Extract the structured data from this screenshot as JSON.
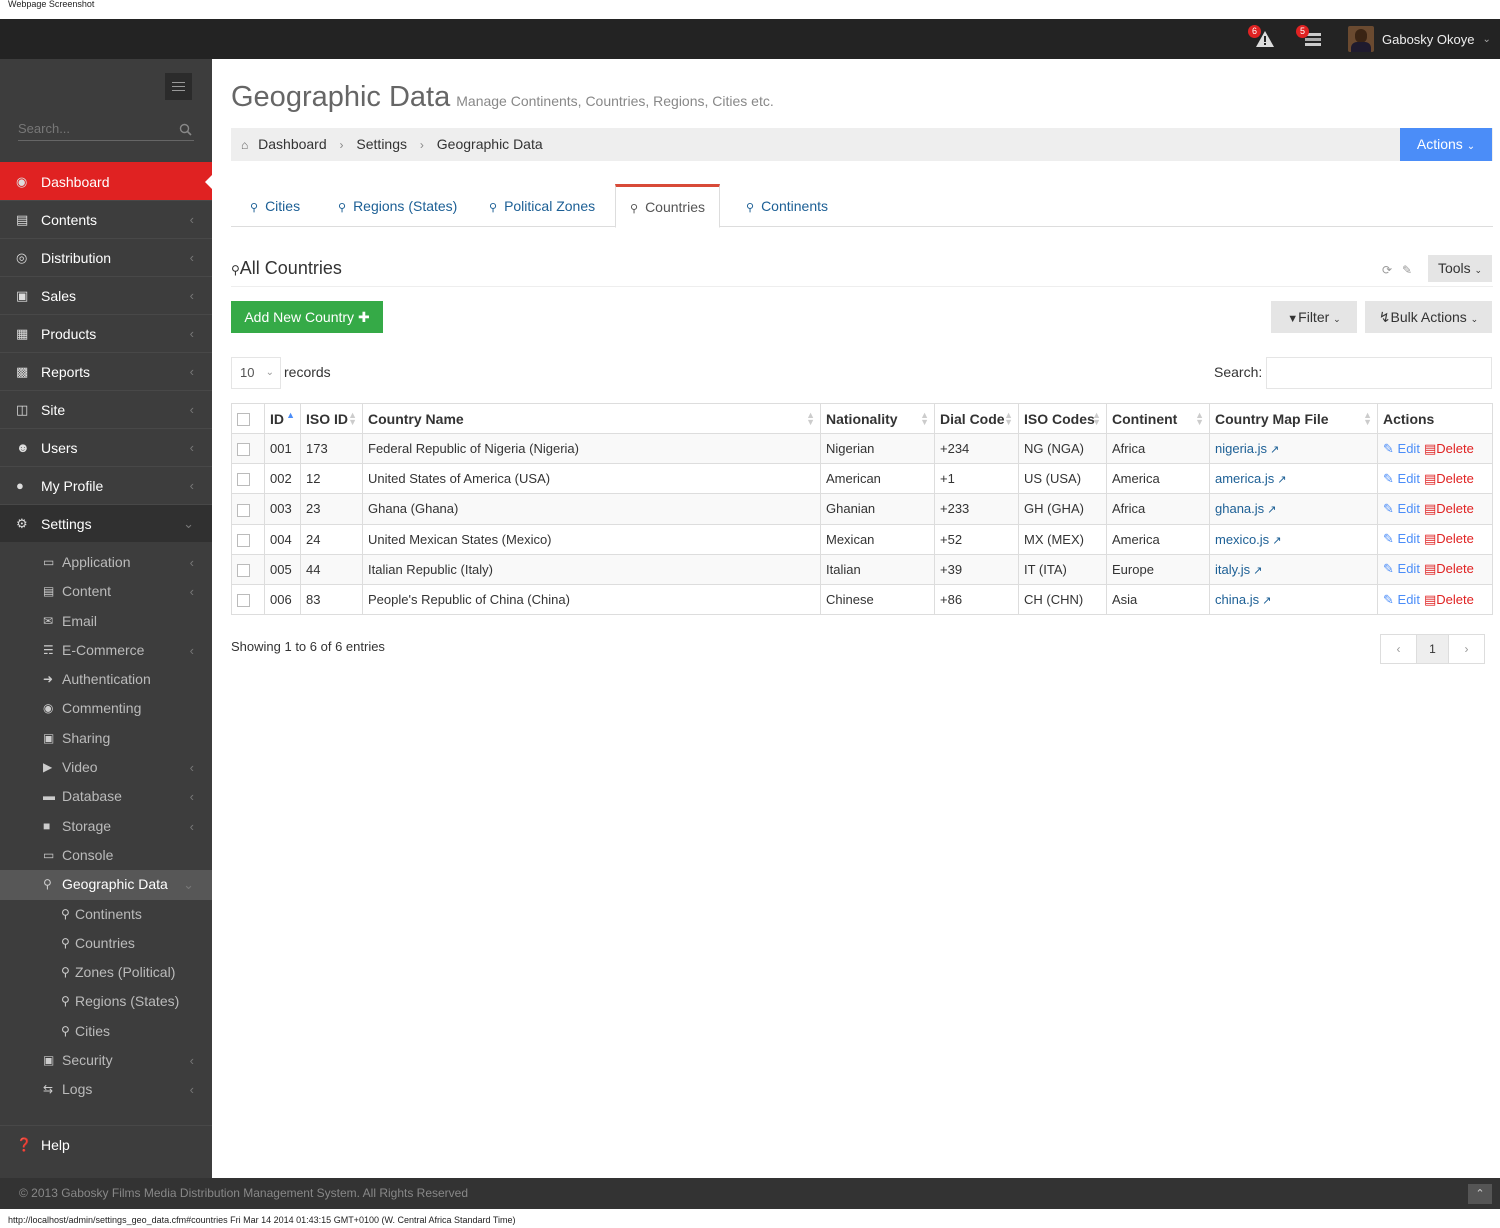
{
  "screenshot_label": "Webpage Screenshot",
  "topbar": {
    "alerts_count": "6",
    "messages_count": "5",
    "user_name": "Gabosky Okoye"
  },
  "sidebar": {
    "search_placeholder": "Search...",
    "items": [
      {
        "label": "Dashboard",
        "icon": "dashboard-icon"
      },
      {
        "label": "Contents",
        "icon": "file-icon"
      },
      {
        "label": "Distribution",
        "icon": "globe-icon"
      },
      {
        "label": "Sales",
        "icon": "money-icon"
      },
      {
        "label": "Products",
        "icon": "briefcase-icon"
      },
      {
        "label": "Reports",
        "icon": "bar-chart-icon"
      },
      {
        "label": "Site",
        "icon": "folder-open-icon"
      },
      {
        "label": "Users",
        "icon": "group-icon"
      },
      {
        "label": "My Profile",
        "icon": "user-icon"
      },
      {
        "label": "Settings",
        "icon": "cogs-icon"
      }
    ],
    "settings_sub": [
      {
        "label": "Application",
        "icon": "desktop-icon"
      },
      {
        "label": "Content",
        "icon": "content-icon"
      },
      {
        "label": "Email",
        "icon": "envelope-icon"
      },
      {
        "label": "E-Commerce",
        "icon": "cart-icon"
      },
      {
        "label": "Authentication",
        "icon": "sign-in-icon"
      },
      {
        "label": "Commenting",
        "icon": "comments-icon"
      },
      {
        "label": "Sharing",
        "icon": "share-icon"
      },
      {
        "label": "Video",
        "icon": "video-icon"
      },
      {
        "label": "Database",
        "icon": "database-icon"
      },
      {
        "label": "Storage",
        "icon": "folder-icon"
      },
      {
        "label": "Console",
        "icon": "laptop-icon"
      },
      {
        "label": "Geographic Data",
        "icon": "map-marker-icon"
      }
    ],
    "geo_sub": [
      "Continents",
      "Countries",
      "Zones (Political)",
      "Regions (States)",
      "Cities"
    ],
    "after_geo": [
      {
        "label": "Security",
        "icon": "lock-icon"
      },
      {
        "label": "Logs",
        "icon": "exchange-icon"
      }
    ],
    "help": "Help"
  },
  "page": {
    "title": "Geographic Data",
    "subtitle": "Manage Continents, Countries, Regions, Cities etc.",
    "breadcrumb": [
      "Dashboard",
      "Settings",
      "Geographic Data"
    ],
    "actions_label": "Actions"
  },
  "tabs": [
    "Cities",
    "Regions (States)",
    "Political Zones",
    "Countries",
    "Continents"
  ],
  "active_tab": "Countries",
  "portlet": {
    "title": "All Countries",
    "tools_label": "Tools",
    "add_label": "Add New Country",
    "filter_label": "Filter",
    "bulk_label": "Bulk Actions",
    "records_value": "10",
    "records_label": "records",
    "search_label": "Search:"
  },
  "table": {
    "headers": [
      "ID",
      "ISO ID",
      "Country Name",
      "Nationality",
      "Dial Code",
      "ISO Codes",
      "Continent",
      "Country Map File",
      "Actions"
    ],
    "rows": [
      [
        "001",
        "173",
        "Federal Republic of Nigeria (Nigeria)",
        "Nigerian",
        "+234",
        "NG (NGA)",
        "Africa",
        "nigeria.js"
      ],
      [
        "002",
        "12",
        "United States of America (USA)",
        "American",
        "+1",
        "US (USA)",
        "America",
        "america.js"
      ],
      [
        "003",
        "23",
        "Ghana (Ghana)",
        "Ghanian",
        "+233",
        "GH (GHA)",
        "Africa",
        "ghana.js"
      ],
      [
        "004",
        "24",
        "United Mexican States (Mexico)",
        "Mexican",
        "+52",
        "MX (MEX)",
        "America",
        "mexico.js"
      ],
      [
        "005",
        "44",
        "Italian Republic (Italy)",
        "Italian",
        "+39",
        "IT (ITA)",
        "Europe",
        "italy.js"
      ],
      [
        "006",
        "83",
        "People's Republic of China (China)",
        "Chinese",
        "+86",
        "CH (CHN)",
        "Asia",
        "china.js"
      ]
    ],
    "edit_label": "Edit",
    "delete_label": "Delete"
  },
  "info": "Showing 1 to 6 of 6 entries",
  "pagination": {
    "prev": "‹",
    "current": "1",
    "next": "›"
  },
  "footer": "© 2013 Gabosky Films Media Distribution Management System. All Rights Reserved",
  "statusbar": "http://localhost/admin/settings_geo_data.cfm#countries Fri Mar 14 2014 01:43:15 GMT+0100 (W. Central Africa Standard Time)",
  "colors": {
    "accent_red": "#e02222",
    "primary_blue": "#4b8df8",
    "success_green": "#35aa47",
    "sidebar_bg": "#3d3d3d"
  }
}
